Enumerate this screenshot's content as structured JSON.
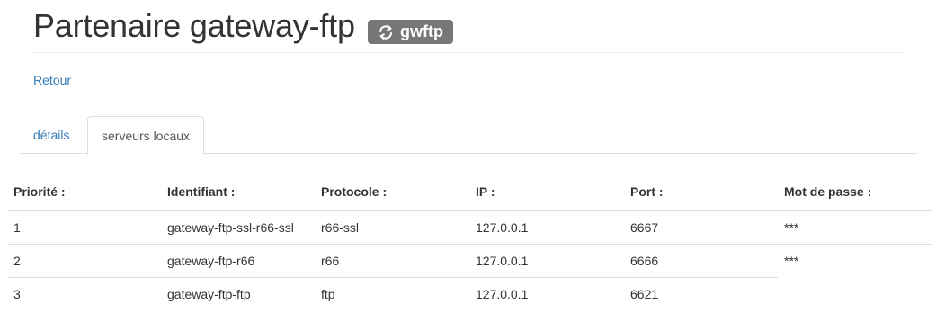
{
  "header": {
    "title": "Partenaire gateway-ftp",
    "badge": {
      "label": "gwftp",
      "icon": "refresh-icon"
    }
  },
  "back_link": "Retour",
  "tabs": [
    {
      "label": "détails",
      "active": false
    },
    {
      "label": "serveurs locaux",
      "active": true
    }
  ],
  "table": {
    "headers": [
      "Priorité :",
      "Identifiant :",
      "Protocole :",
      "IP :",
      "Port :",
      "Mot de passe :"
    ],
    "rows": [
      [
        "1",
        "gateway-ftp-ssl-r66-ssl",
        "r66-ssl",
        "127.0.0.1",
        "6667",
        "***"
      ],
      [
        "2",
        "gateway-ftp-r66",
        "r66",
        "127.0.0.1",
        "6666",
        "***"
      ],
      [
        "3",
        "gateway-ftp-ftp",
        "ftp",
        "127.0.0.1",
        "6621",
        ""
      ]
    ]
  },
  "colors": {
    "link": "#337ab7",
    "badge": "#777777",
    "text": "#333333",
    "border": "#dddddd"
  }
}
